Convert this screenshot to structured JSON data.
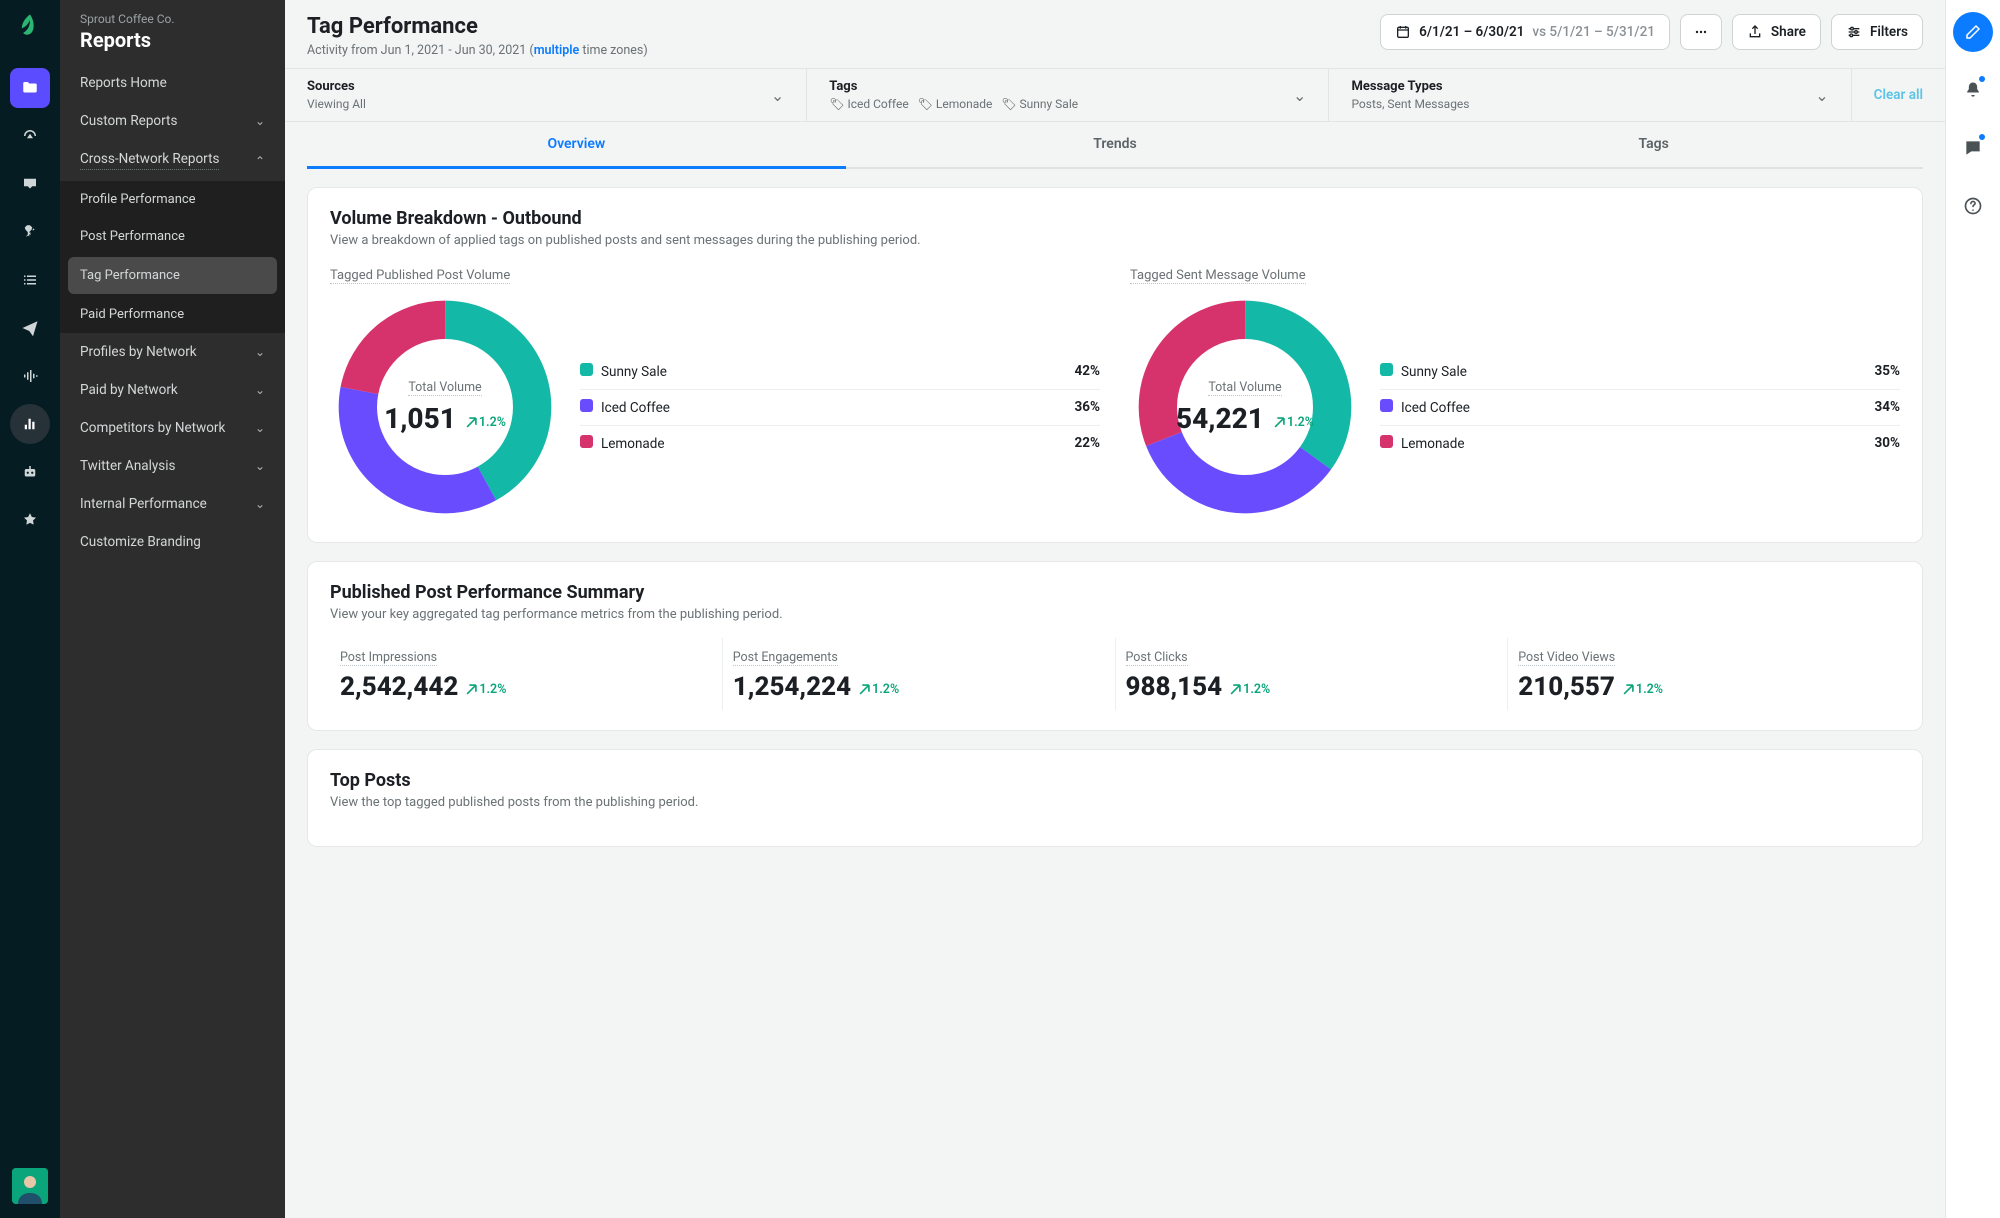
{
  "org": "Sprout Coffee Co.",
  "section": "Reports",
  "sidebar": {
    "home": "Reports Home",
    "custom": "Custom Reports",
    "cross": "Cross-Network Reports",
    "cross_items": [
      "Profile Performance",
      "Post Performance",
      "Tag Performance",
      "Paid Performance"
    ],
    "profiles": "Profiles by Network",
    "paid": "Paid by Network",
    "competitors": "Competitors by Network",
    "twitter": "Twitter Analysis",
    "internal": "Internal Performance",
    "branding": "Customize Branding"
  },
  "header": {
    "title": "Tag Performance",
    "subtitle_pre": "Activity from Jun 1, 2021 - Jun 30, 2021 (",
    "subtitle_link": "multiple",
    "subtitle_post": " time zones)",
    "daterange_main": "6/1/21 – 6/30/21",
    "daterange_vs": " vs 5/1/21 – 5/31/21",
    "share": "Share",
    "filters": "Filters"
  },
  "filters": {
    "sources_label": "Sources",
    "sources_value": "Viewing All",
    "tags_label": "Tags",
    "tag1": "Iced Coffee",
    "tag2": "Lemonade",
    "tag3": "Sunny Sale",
    "msgtypes_label": "Message Types",
    "msgtypes_value": "Posts, Sent Messages",
    "clear": "Clear all"
  },
  "tabs": {
    "overview": "Overview",
    "trends": "Trends",
    "tags": "Tags"
  },
  "volume": {
    "card_title": "Volume Breakdown - Outbound",
    "card_desc": "View a breakdown of applied tags on published posts and sent messages during the publishing period.",
    "posts_title": "Tagged Published Post Volume",
    "msgs_title": "Tagged Sent Message Volume",
    "center_label": "Total Volume",
    "posts_total": "1,051",
    "msgs_total": "54,221",
    "delta": "1.2%"
  },
  "legend": {
    "p": [
      {
        "label": "Sunny Sale",
        "pct": "42%",
        "color": "#14b8a6"
      },
      {
        "label": "Iced Coffee",
        "pct": "36%",
        "color": "#6a4cff"
      },
      {
        "label": "Lemonade",
        "pct": "22%",
        "color": "#d6336c"
      }
    ],
    "m": [
      {
        "label": "Sunny Sale",
        "pct": "35%",
        "color": "#14b8a6"
      },
      {
        "label": "Iced Coffee",
        "pct": "34%",
        "color": "#6a4cff"
      },
      {
        "label": "Lemonade",
        "pct": "30%",
        "color": "#d6336c"
      }
    ]
  },
  "summary": {
    "title": "Published Post Performance Summary",
    "desc": "View your key aggregated tag performance metrics from the publishing period.",
    "metrics": [
      {
        "label": "Post Impressions",
        "value": "2,542,442",
        "delta": "1.2%"
      },
      {
        "label": "Post Engagements",
        "value": "1,254,224",
        "delta": "1.2%"
      },
      {
        "label": "Post Clicks",
        "value": "988,154",
        "delta": "1.2%"
      },
      {
        "label": "Post Video Views",
        "value": "210,557",
        "delta": "1.2%"
      }
    ]
  },
  "topposts": {
    "title": "Top Posts",
    "desc": "View the top tagged published posts from the publishing period."
  },
  "chart_data": [
    {
      "type": "pie",
      "title": "Tagged Published Post Volume",
      "total": 1051,
      "series": [
        {
          "name": "Sunny Sale",
          "value": 42
        },
        {
          "name": "Iced Coffee",
          "value": 36
        },
        {
          "name": "Lemonade",
          "value": 22
        }
      ],
      "unit": "percent"
    },
    {
      "type": "pie",
      "title": "Tagged Sent Message Volume",
      "total": 54221,
      "series": [
        {
          "name": "Sunny Sale",
          "value": 35
        },
        {
          "name": "Iced Coffee",
          "value": 34
        },
        {
          "name": "Lemonade",
          "value": 30
        }
      ],
      "unit": "percent"
    }
  ]
}
